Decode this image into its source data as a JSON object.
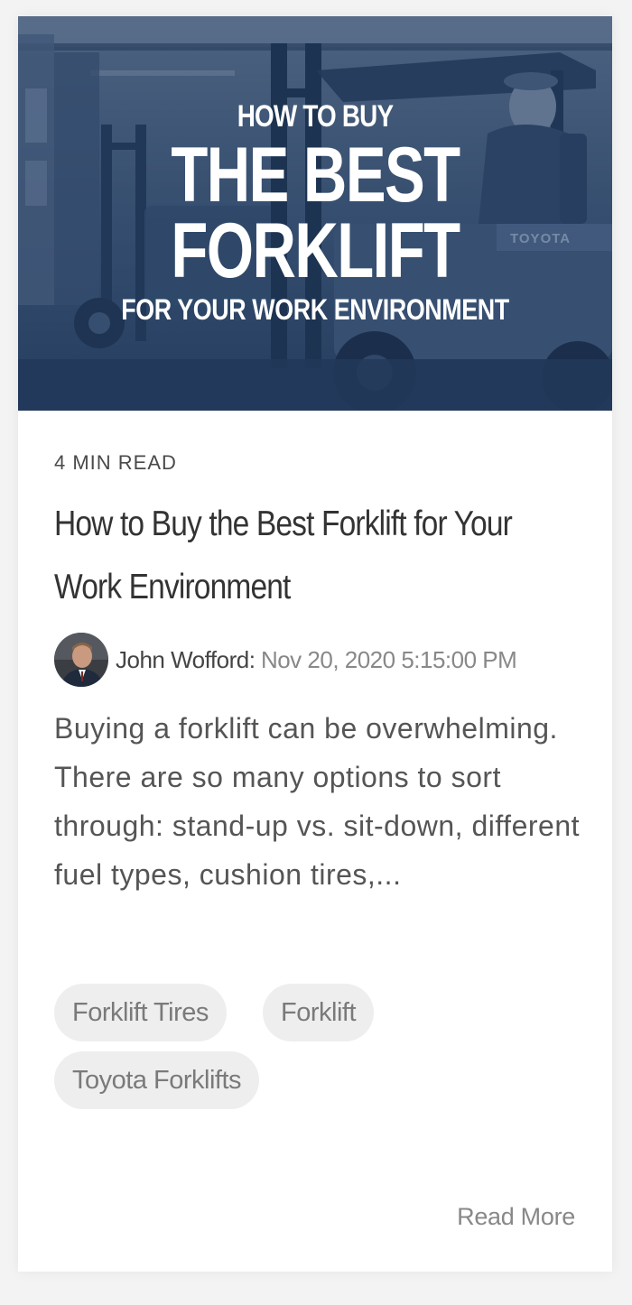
{
  "hero": {
    "line1": "HOW TO BUY",
    "line2": "THE BEST",
    "line3": "FORKLIFT",
    "line4": "FOR YOUR WORK ENVIRONMENT",
    "overlay_color": "#2b4466",
    "brand_mark": "TOYOTA"
  },
  "post": {
    "read_time": "4 MIN READ",
    "title": "How to Buy the Best Forklift for Your Work Environment",
    "author": "John Wofford",
    "separator": ":",
    "date": "Nov 20, 2020 5:15:00 PM",
    "excerpt": "Buying a forklift can be overwhelming. There are so many options to sort through: stand-up vs. sit-down, different fuel types, cushion tires,...",
    "read_more": "Read More"
  },
  "tags": [
    "Forklift Tires",
    "Forklift",
    "Toyota Forklifts"
  ],
  "colors": {
    "page_bg": "#f3f3f3",
    "card_bg": "#ffffff",
    "tag_bg": "#eeeeee",
    "text_dark": "#333333",
    "text_muted": "#888888"
  }
}
